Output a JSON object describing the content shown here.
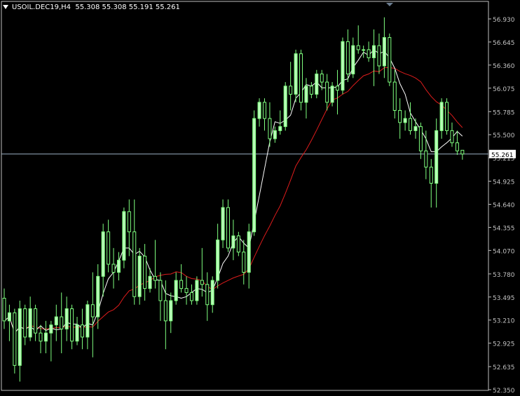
{
  "header": {
    "symbol": "USOIL.DEC19,H4",
    "ohlc": "55.308 55.308 55.191 55.261"
  },
  "colors": {
    "background": "#000000",
    "axis": "#c0c0c0",
    "candle_bull": "#b8ffb8",
    "candle_bear": "#000000",
    "wick": "#7fff7f",
    "ma_fast": "#ffffff",
    "ma_slow": "#dd1c1c",
    "bid_line": "#9ab0c4",
    "price_label_bg": "#ffffff"
  },
  "chart_data": {
    "type": "candlestick",
    "timeframe": "H4",
    "ylim": [
      52.35,
      56.93
    ],
    "y_ticks": [
      "56.930",
      "56.645",
      "56.360",
      "56.075",
      "55.785",
      "55.500",
      "55.215",
      "54.925",
      "54.640",
      "54.355",
      "54.070",
      "53.780",
      "53.495",
      "53.210",
      "52.925",
      "52.635",
      "52.350"
    ],
    "current_price": "55.261",
    "candles": [
      [
        53.48,
        53.6,
        53.1,
        53.2
      ],
      [
        53.2,
        53.4,
        52.95,
        53.3
      ],
      [
        53.3,
        53.35,
        52.55,
        52.65
      ],
      [
        52.65,
        53.45,
        52.45,
        53.35
      ],
      [
        53.35,
        53.4,
        52.9,
        53.0
      ],
      [
        53.0,
        53.5,
        52.95,
        53.35
      ],
      [
        53.35,
        53.4,
        52.95,
        53.05
      ],
      [
        53.05,
        53.15,
        52.8,
        52.95
      ],
      [
        52.95,
        53.2,
        52.8,
        53.05
      ],
      [
        53.05,
        53.2,
        52.7,
        53.15
      ],
      [
        53.15,
        53.4,
        52.95,
        53.25
      ],
      [
        53.25,
        53.55,
        52.8,
        53.1
      ],
      [
        53.1,
        53.5,
        52.95,
        53.35
      ],
      [
        53.35,
        53.4,
        52.85,
        52.95
      ],
      [
        52.95,
        53.25,
        52.9,
        53.15
      ],
      [
        53.15,
        53.35,
        52.85,
        53.0
      ],
      [
        53.0,
        53.45,
        52.85,
        53.4
      ],
      [
        53.4,
        53.8,
        52.75,
        53.25
      ],
      [
        53.25,
        53.9,
        53.1,
        53.75
      ],
      [
        53.75,
        54.4,
        53.5,
        54.3
      ],
      [
        54.3,
        54.45,
        53.8,
        53.9
      ],
      [
        53.9,
        54.1,
        53.6,
        53.8
      ],
      [
        53.8,
        54.05,
        53.7,
        53.95
      ],
      [
        53.95,
        54.6,
        53.85,
        54.55
      ],
      [
        54.55,
        54.7,
        54.0,
        54.3
      ],
      [
        54.3,
        54.7,
        53.4,
        53.5
      ],
      [
        53.5,
        54.1,
        53.4,
        54.0
      ],
      [
        54.0,
        54.15,
        53.45,
        53.6
      ],
      [
        53.6,
        53.85,
        53.55,
        53.75
      ],
      [
        53.75,
        54.2,
        53.6,
        53.7
      ],
      [
        53.7,
        53.8,
        53.2,
        53.45
      ],
      [
        53.45,
        53.7,
        52.85,
        53.2
      ],
      [
        53.2,
        53.55,
        53.05,
        53.45
      ],
      [
        53.45,
        53.8,
        53.4,
        53.7
      ],
      [
        53.7,
        53.9,
        53.55,
        53.6
      ],
      [
        53.6,
        53.75,
        53.4,
        53.55
      ],
      [
        53.55,
        53.65,
        53.4,
        53.45
      ],
      [
        53.45,
        53.75,
        53.4,
        53.7
      ],
      [
        53.7,
        54.1,
        53.5,
        53.65
      ],
      [
        53.65,
        53.8,
        53.2,
        53.4
      ],
      [
        53.4,
        53.75,
        53.3,
        53.7
      ],
      [
        53.7,
        54.4,
        53.6,
        54.2
      ],
      [
        54.2,
        54.7,
        54.1,
        54.6
      ],
      [
        54.6,
        54.7,
        54.05,
        54.1
      ],
      [
        54.1,
        54.45,
        53.95,
        54.25
      ],
      [
        54.25,
        54.3,
        54.0,
        54.05
      ],
      [
        54.05,
        54.2,
        53.65,
        53.8
      ],
      [
        53.8,
        54.4,
        53.6,
        54.3
      ],
      [
        54.3,
        55.8,
        54.25,
        55.7
      ],
      [
        55.7,
        55.95,
        55.6,
        55.9
      ],
      [
        55.9,
        55.95,
        55.55,
        55.7
      ],
      [
        55.7,
        55.9,
        55.35,
        55.45
      ],
      [
        55.45,
        55.6,
        55.4,
        55.55
      ],
      [
        55.55,
        55.8,
        55.5,
        55.6
      ],
      [
        55.6,
        56.15,
        55.55,
        56.1
      ],
      [
        56.1,
        56.4,
        55.8,
        56.0
      ],
      [
        56.0,
        56.55,
        55.9,
        56.5
      ],
      [
        56.5,
        56.55,
        55.8,
        55.9
      ],
      [
        55.9,
        56.2,
        55.7,
        56.1
      ],
      [
        56.1,
        56.15,
        55.95,
        56.0
      ],
      [
        56.0,
        56.3,
        55.95,
        56.25
      ],
      [
        56.25,
        56.3,
        56.05,
        56.15
      ],
      [
        56.15,
        56.25,
        55.8,
        55.9
      ],
      [
        55.9,
        56.15,
        55.85,
        56.1
      ],
      [
        56.1,
        56.3,
        55.75,
        56.05
      ],
      [
        56.05,
        56.7,
        56.0,
        56.65
      ],
      [
        56.65,
        56.8,
        56.15,
        56.25
      ],
      [
        56.25,
        56.7,
        56.2,
        56.6
      ],
      [
        56.6,
        56.85,
        56.5,
        56.55
      ],
      [
        56.55,
        56.6,
        56.45,
        56.55
      ],
      [
        56.55,
        56.65,
        56.4,
        56.45
      ],
      [
        56.45,
        56.8,
        56.1,
        56.6
      ],
      [
        56.6,
        56.75,
        56.25,
        56.35
      ],
      [
        56.35,
        56.95,
        56.2,
        56.7
      ],
      [
        56.7,
        56.75,
        56.1,
        56.15
      ],
      [
        56.15,
        56.3,
        55.7,
        55.8
      ],
      [
        55.8,
        55.95,
        55.45,
        55.65
      ],
      [
        55.65,
        55.8,
        55.55,
        55.7
      ],
      [
        55.7,
        55.9,
        55.5,
        55.55
      ],
      [
        55.55,
        55.7,
        55.45,
        55.6
      ],
      [
        55.6,
        55.65,
        55.2,
        55.3
      ],
      [
        55.3,
        55.55,
        54.95,
        55.1
      ],
      [
        55.1,
        55.2,
        54.6,
        54.9
      ],
      [
        54.9,
        55.7,
        54.6,
        55.55
      ],
      [
        55.55,
        55.95,
        55.45,
        55.9
      ],
      [
        55.9,
        55.95,
        55.5,
        55.55
      ],
      [
        55.55,
        55.65,
        55.35,
        55.4
      ],
      [
        55.4,
        55.55,
        55.25,
        55.3
      ],
      [
        55.308,
        55.308,
        55.191,
        55.261
      ]
    ]
  }
}
